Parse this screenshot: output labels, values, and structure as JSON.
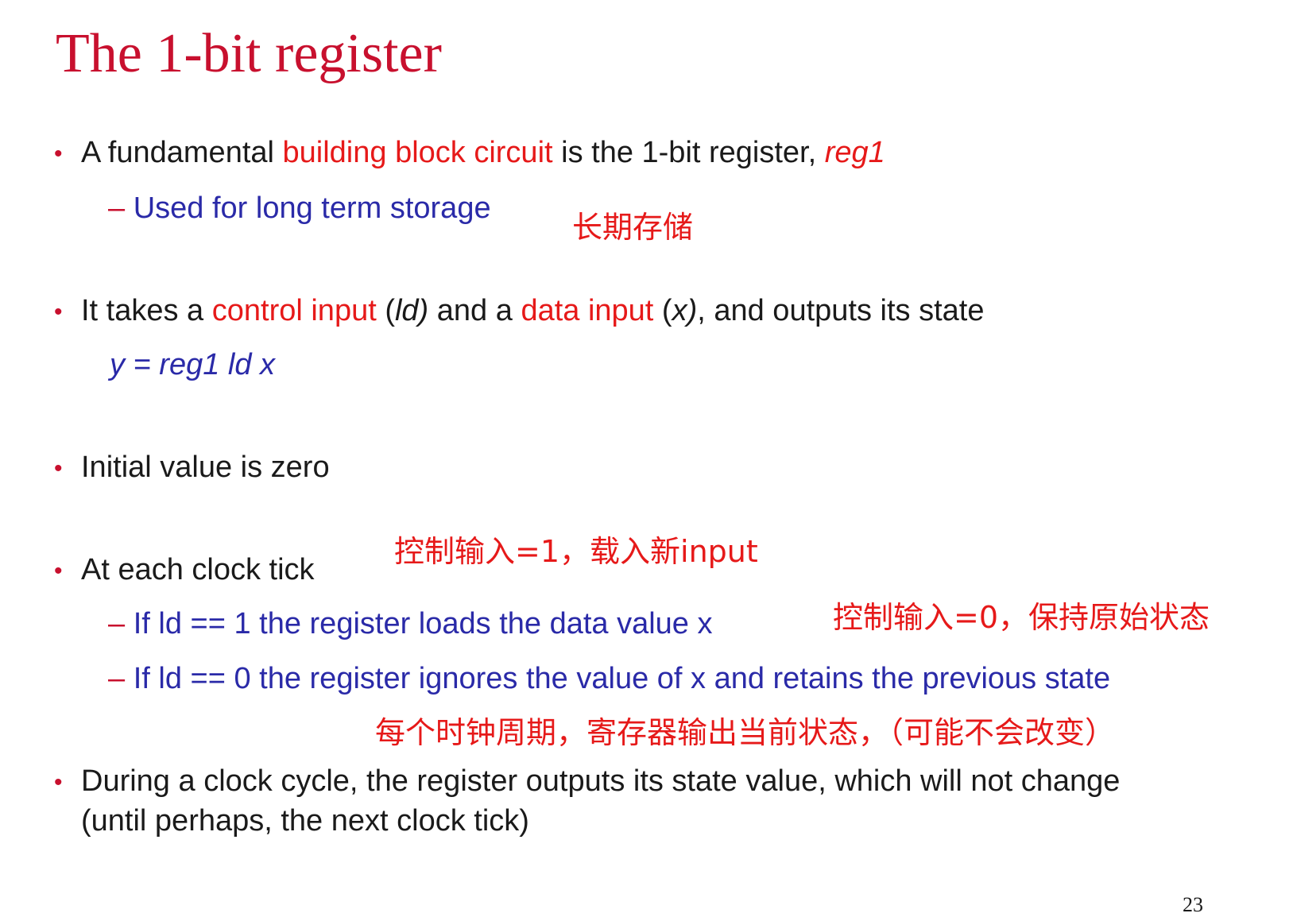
{
  "title": "The 1-bit register",
  "bullets": {
    "b1": {
      "p1": "A fundamental ",
      "p2": "building block circuit",
      "p3": " is the 1-bit register, ",
      "p4": "reg1"
    },
    "b1_sub": "Used for long term storage",
    "note1": "长期存储",
    "b2": {
      "p1": "It takes a ",
      "p2": "control input",
      "p3": " (",
      "p4": "ld)",
      "p5": " and a ",
      "p6": "data input",
      "p7": " (",
      "p8": "x)",
      "p9": ", and outputs its state"
    },
    "b2_formula": "y = reg1 ld x",
    "b3": "Initial value is zero",
    "b4": "At each clock tick",
    "note2": "控制输入=1，载入新input",
    "b4_sub1": "If ld == 1 the register loads the data value x",
    "note3": "控制输入=0，保持原始状态",
    "b4_sub2": "If ld == 0 the register ignores the value of x and retains the previous state",
    "note4": "每个时钟周期，寄存器输出当前状态，（可能不会改变）",
    "b5_line1": "During a clock cycle, the register outputs its state value, which will not change",
    "b5_line2": "(until perhaps, the next clock tick)"
  },
  "page_number": "23",
  "bullet_glyph": "•",
  "dash_glyph": "–",
  "colors": {
    "title": "#c8102e",
    "highlight": "#e61919",
    "sub": "#2a2aa8",
    "text": "#1a1a1a"
  }
}
